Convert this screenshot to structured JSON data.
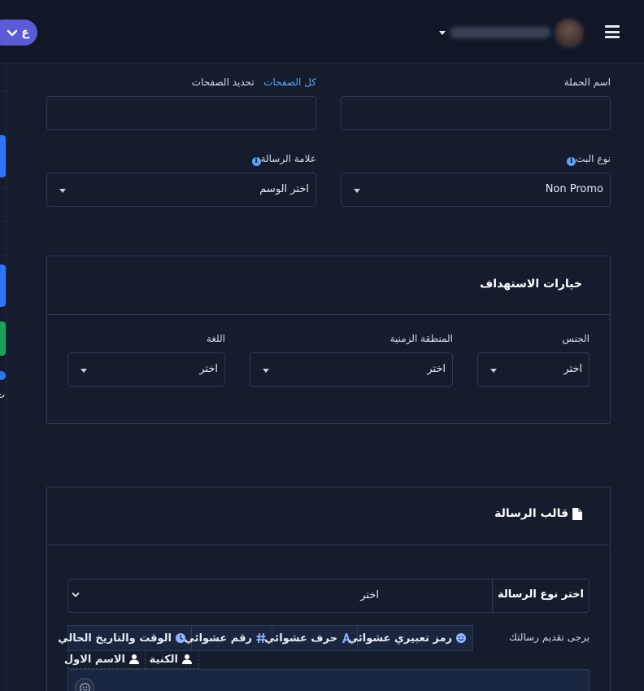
{
  "header": {
    "language_pill": "ع",
    "user_name": "",
    "accent_color": "#5b5bd6"
  },
  "sidebar": {
    "partial_text": "ت"
  },
  "form": {
    "campaign_name": {
      "label": "اسم الحملة",
      "value": ""
    },
    "pages": {
      "label": "تحديد الصفحات",
      "all_pages_link": "كل الصفحات",
      "value": ""
    },
    "broadcast_type": {
      "label": "نوع البث",
      "value": "Non Promo"
    },
    "message_tag": {
      "label": "علامة الرسالة",
      "value": "اختر الوسم"
    }
  },
  "targeting": {
    "title": "خيارات الاستهداف",
    "gender": {
      "label": "الجنس",
      "value": "اختر"
    },
    "timezone": {
      "label": "المنطقة الزمنية",
      "value": "اختر"
    },
    "language": {
      "label": "اللغة",
      "value": "اختر"
    }
  },
  "template": {
    "title": "قالب الرسالة",
    "icon": "file-icon",
    "message_type": {
      "label": "اختر نوع الرسالة",
      "value": "اختر"
    },
    "prompt": "يرجى تقديم رسالتك",
    "tags": [
      {
        "label": "رمز تعبيري عشوائي",
        "icon": "smile-icon"
      },
      {
        "label": "حرف عشوائي",
        "icon": "letter-a-icon"
      },
      {
        "label": "رقم عشوائي",
        "icon": "hash-icon"
      },
      {
        "label": "الوقت والتاريخ الحالي",
        "icon": "clock-icon"
      }
    ],
    "tags_row2": [
      {
        "label": "الكنية",
        "icon": "user-icon"
      },
      {
        "label": "الاسم الاول",
        "icon": "user-icon"
      }
    ],
    "message_value": ""
  }
}
